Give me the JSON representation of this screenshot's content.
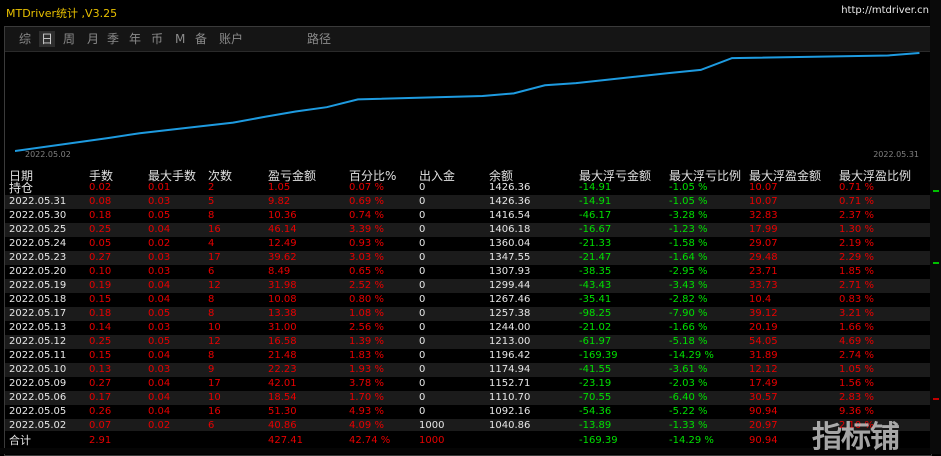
{
  "window": {
    "title": "MTDriver统计 ,V3.25",
    "url": "http://mtdriver.cn"
  },
  "tabs": [
    {
      "label": "综",
      "active": false
    },
    {
      "label": "日",
      "active": true
    },
    {
      "label": "周",
      "active": false
    },
    {
      "label": "月",
      "active": false
    },
    {
      "label": "季",
      "active": false
    },
    {
      "label": "年",
      "active": false
    },
    {
      "label": "币",
      "active": false
    },
    {
      "label": "M",
      "active": false
    },
    {
      "label": "备",
      "active": false
    },
    {
      "label": "账户",
      "active": false
    },
    {
      "label": "路径",
      "active": false
    }
  ],
  "chart_data": {
    "type": "line",
    "title": "",
    "xlabel": "",
    "ylabel": "",
    "start_label": "2022.05.02",
    "end_label": "2022.05.31",
    "series": [
      {
        "color": "#1e9be0",
        "x": [
          "2022.05.02",
          "2022.05.05",
          "2022.05.06",
          "2022.05.09",
          "2022.05.10",
          "2022.05.11",
          "2022.05.12",
          "2022.05.13",
          "2022.05.17",
          "2022.05.18",
          "2022.05.19",
          "2022.05.20",
          "2022.05.23",
          "2022.05.24",
          "2022.05.25",
          "2022.05.30",
          "2022.05.31"
        ],
        "values": [
          1040.86,
          1092.16,
          1110.7,
          1152.71,
          1174.94,
          1196.42,
          1213.0,
          1244.0,
          1257.38,
          1267.46,
          1299.44,
          1307.93,
          1347.55,
          1360.04,
          1406.18,
          1416.54,
          1426.36
        ]
      }
    ],
    "grid": false,
    "legend": "none"
  },
  "table": {
    "headers": [
      "日期",
      "手数",
      "最大手数",
      "次数",
      "盈亏金额",
      "百分比%",
      "出入金",
      "余额",
      "最大浮亏金额",
      "最大浮亏比例",
      "最大浮盈金额",
      "最大浮盈比例"
    ],
    "rows": [
      [
        "持仓",
        "0.02",
        "0.01",
        "2",
        "1.05",
        "0.07 %",
        "0",
        "1426.36",
        "-14.91",
        "-1.05 %",
        "10.07",
        "0.71 %"
      ],
      [
        "2022.05.31",
        "0.08",
        "0.03",
        "5",
        "9.82",
        "0.69 %",
        "0",
        "1426.36",
        "-14.91",
        "-1.05 %",
        "10.07",
        "0.71 %"
      ],
      [
        "2022.05.30",
        "0.18",
        "0.05",
        "8",
        "10.36",
        "0.74 %",
        "0",
        "1416.54",
        "-46.17",
        "-3.28 %",
        "32.83",
        "2.37 %"
      ],
      [
        "2022.05.25",
        "0.25",
        "0.04",
        "16",
        "46.14",
        "3.39 %",
        "0",
        "1406.18",
        "-16.67",
        "-1.23 %",
        "17.99",
        "1.30 %"
      ],
      [
        "2022.05.24",
        "0.05",
        "0.02",
        "4",
        "12.49",
        "0.93 %",
        "0",
        "1360.04",
        "-21.33",
        "-1.58 %",
        "29.07",
        "2.19 %"
      ],
      [
        "2022.05.23",
        "0.27",
        "0.03",
        "17",
        "39.62",
        "3.03 %",
        "0",
        "1347.55",
        "-21.47",
        "-1.64 %",
        "29.48",
        "2.29 %"
      ],
      [
        "2022.05.20",
        "0.10",
        "0.03",
        "6",
        "8.49",
        "0.65 %",
        "0",
        "1307.93",
        "-38.35",
        "-2.95 %",
        "23.71",
        "1.85 %"
      ],
      [
        "2022.05.19",
        "0.19",
        "0.04",
        "12",
        "31.98",
        "2.52 %",
        "0",
        "1299.44",
        "-43.43",
        "-3.43 %",
        "33.73",
        "2.71 %"
      ],
      [
        "2022.05.18",
        "0.15",
        "0.04",
        "8",
        "10.08",
        "0.80 %",
        "0",
        "1267.46",
        "-35.41",
        "-2.82 %",
        "10.4",
        "0.83 %"
      ],
      [
        "2022.05.17",
        "0.18",
        "0.05",
        "8",
        "13.38",
        "1.08 %",
        "0",
        "1257.38",
        "-98.25",
        "-7.90 %",
        "39.12",
        "3.21 %"
      ],
      [
        "2022.05.13",
        "0.14",
        "0.03",
        "10",
        "31.00",
        "2.56 %",
        "0",
        "1244.00",
        "-21.02",
        "-1.66 %",
        "20.19",
        "1.66 %"
      ],
      [
        "2022.05.12",
        "0.25",
        "0.05",
        "12",
        "16.58",
        "1.39 %",
        "0",
        "1213.00",
        "-61.97",
        "-5.18 %",
        "54.05",
        "4.69 %"
      ],
      [
        "2022.05.11",
        "0.15",
        "0.04",
        "8",
        "21.48",
        "1.83 %",
        "0",
        "1196.42",
        "-169.39",
        "-14.29 %",
        "31.89",
        "2.74 %"
      ],
      [
        "2022.05.10",
        "0.13",
        "0.03",
        "9",
        "22.23",
        "1.93 %",
        "0",
        "1174.94",
        "-41.55",
        "-3.61 %",
        "12.12",
        "1.05 %"
      ],
      [
        "2022.05.09",
        "0.27",
        "0.04",
        "17",
        "42.01",
        "3.78 %",
        "0",
        "1152.71",
        "-23.19",
        "-2.03 %",
        "17.49",
        "1.56 %"
      ],
      [
        "2022.05.06",
        "0.17",
        "0.04",
        "10",
        "18.54",
        "1.70 %",
        "0",
        "1110.70",
        "-70.55",
        "-6.40 %",
        "30.57",
        "2.83 %"
      ],
      [
        "2022.05.05",
        "0.26",
        "0.04",
        "16",
        "51.30",
        "4.93 %",
        "0",
        "1092.16",
        "-54.36",
        "-5.22 %",
        "90.94",
        "9.36 %"
      ],
      [
        "2022.05.02",
        "0.07",
        "0.02",
        "6",
        "40.86",
        "4.09 %",
        "1000",
        "1040.86",
        "-13.89",
        "-1.33 %",
        "20.97",
        "2.10 %"
      ]
    ],
    "total": [
      "合计",
      "2.91",
      "",
      "",
      "427.41",
      "42.74 %",
      "1000",
      "",
      "-169.39",
      "-14.29 %",
      "90.94",
      ""
    ]
  },
  "colors": {
    "positive": "#e80000",
    "negative": "#00e000",
    "neutral": "#e6e6e6",
    "line": "#1e9be0",
    "title": "#e8c000"
  },
  "watermark": "指标铺"
}
